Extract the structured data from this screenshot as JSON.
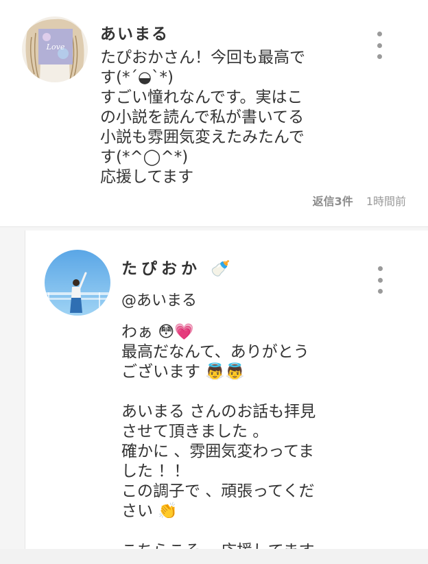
{
  "comment": {
    "author": "あいまる",
    "body": "たぴおかさん！今回も最高で\nす(*´◒`*)\nすごい憧れなんです。実はこ\nの小説を読んで私が書いてる\n小説も雰囲気変えたみたんで\nす(*^◯^*)\n応援してます",
    "replies_label": "返信3件",
    "time": "1時間前",
    "more_icon": "kebab-menu-icon",
    "avatar_icon": "love-avatar"
  },
  "reply": {
    "author": "たぴおか 🍼",
    "mention": "@あいまる",
    "body": "わぁ 😳💗\n最高だなんて、ありがとう\nございます 👼👼\n\nあいまる さんのお話も拝見\nさせて頂きました 。\n確かに 、雰囲気変わってま\nした ！！\nこの調子で 、頑張ってくだ\nさい 👏\n\nこちらこそ 、応援してます",
    "more_icon": "kebab-menu-icon",
    "avatar_icon": "sky-photo-avatar"
  }
}
